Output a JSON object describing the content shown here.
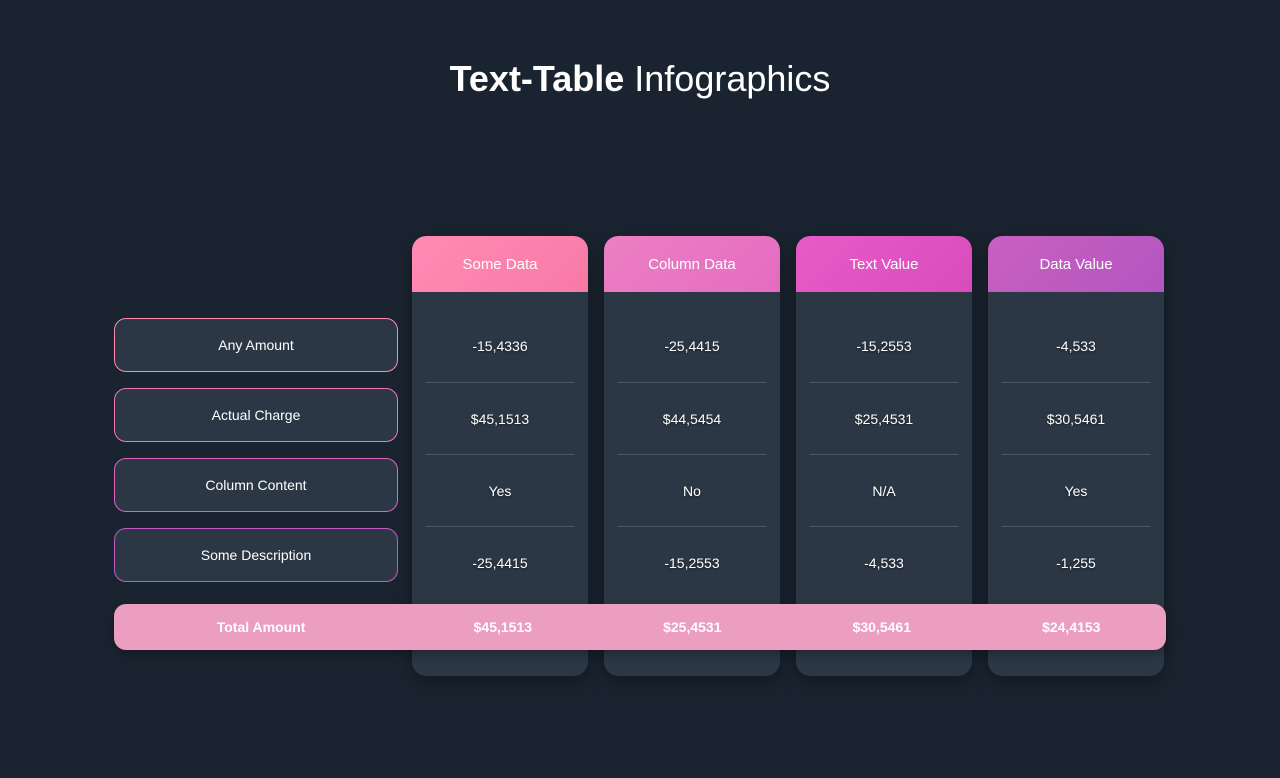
{
  "title": {
    "bold": "Text-Table",
    "rest": " Infographics"
  },
  "columns": [
    {
      "header": "Some Data",
      "cells": [
        "-15,4336",
        "$45,1513",
        "Yes",
        "-25,4415"
      ],
      "total": "$45,1513"
    },
    {
      "header": "Column Data",
      "cells": [
        "-25,4415",
        "$44,5454",
        "No",
        "-15,2553"
      ],
      "total": "$25,4531"
    },
    {
      "header": "Text Value",
      "cells": [
        "-15,2553",
        "$25,4531",
        "N/A",
        "-4,533"
      ],
      "total": "$30,5461"
    },
    {
      "header": "Data Value",
      "cells": [
        "-4,533",
        "$30,5461",
        "Yes",
        "-1,255"
      ],
      "total": "$24,4153"
    }
  ],
  "rows": [
    "Any Amount",
    "Actual Charge",
    "Column Content",
    "Some Description"
  ],
  "totalLabel": "Total Amount"
}
